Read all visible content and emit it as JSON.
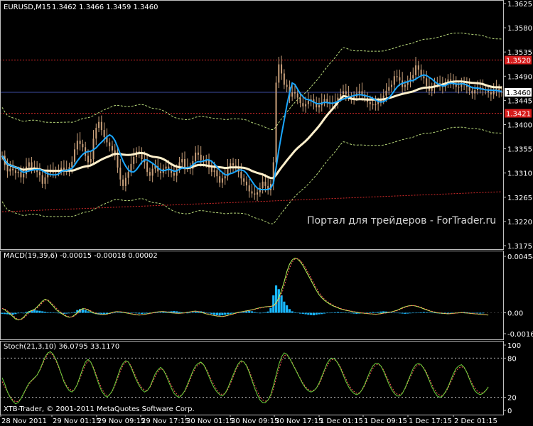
{
  "window": {
    "title": "EURUSD,M15",
    "ohlc": "1.3462 1.3466 1.3459 1.3460"
  },
  "watermark": "Портал для трейдеров - ForTrader.ru",
  "footer": "XTB-Trader, © 2001-2011 MetaQuotes Software Corp.",
  "colors": {
    "background": "#000000",
    "frame": "#c0c0c0",
    "candle": "#c9a07a",
    "ma_fast": "#1aa7ff",
    "ma_slow": "#fff0cc",
    "channel": "#b7d87a",
    "red_level": "#d62a2a",
    "macd_hist": "#18b7ff",
    "macd_signal": "#b8ff5a",
    "macd_red": "#ff5a5a",
    "stoch_main": "#6bd23a",
    "stoch_signal": "#ff5a5a",
    "text": "#ffffff"
  },
  "chart_data": [
    {
      "type": "candlestick",
      "title": "EURUSD,M15",
      "y_ticks": [
        "1.3625",
        "1.3580",
        "1.3535",
        "1.3490",
        "1.3445",
        "1.3400",
        "1.3355",
        "1.3310",
        "1.3265",
        "1.3220",
        "1.3175"
      ],
      "ylim": [
        1.3175,
        1.3625
      ],
      "current_price": "1.3460",
      "red_levels": [
        "1.3520",
        "1.3421"
      ],
      "x_labels": [
        "28 Nov 2011",
        "29 Nov 01:15",
        "29 Nov 09:15",
        "29 Nov 17:15",
        "30 Nov 01:15",
        "30 Nov 09:15",
        "30 Nov 17:15",
        "1 Dec 01:15",
        "1 Dec 09:15",
        "1 Dec 17:15",
        "2 Dec 01:15"
      ],
      "x_positions": [
        0,
        72,
        135,
        197,
        260,
        323,
        385,
        448,
        510,
        573,
        637
      ],
      "series": [
        {
          "name": "close",
          "values": [
            1.3342,
            1.3325,
            1.3313,
            1.3318,
            1.3315,
            1.331,
            1.3312,
            1.3302,
            1.3308,
            1.3322,
            1.333,
            1.3321,
            1.3318,
            1.3312,
            1.3306,
            1.329,
            1.3302,
            1.3312,
            1.3311,
            1.3314,
            1.3312,
            1.3316,
            1.332,
            1.3317,
            1.3314,
            1.3321,
            1.3331,
            1.3354,
            1.337,
            1.3364,
            1.3358,
            1.3342,
            1.333,
            1.3336,
            1.3374,
            1.3394,
            1.3405,
            1.339,
            1.3377,
            1.3367,
            1.336,
            1.3352,
            1.3342,
            1.332,
            1.3298,
            1.3286,
            1.3301,
            1.3312,
            1.3327,
            1.334,
            1.335,
            1.3346,
            1.3336,
            1.333,
            1.3312,
            1.3305,
            1.3318,
            1.3323,
            1.3313,
            1.331,
            1.3318,
            1.3322,
            1.3315,
            1.331,
            1.3305,
            1.3318,
            1.333,
            1.3336,
            1.332,
            1.3321,
            1.3318,
            1.3332,
            1.3348,
            1.3344,
            1.3334,
            1.333,
            1.3334,
            1.332,
            1.3312,
            1.3315,
            1.3304,
            1.3292,
            1.33,
            1.3304,
            1.332,
            1.3328,
            1.3324,
            1.3322,
            1.3312,
            1.33,
            1.3294,
            1.3287,
            1.3276,
            1.3272,
            1.327,
            1.3274,
            1.3282,
            1.3294,
            1.3286,
            1.3278,
            1.329,
            1.333,
            1.3478,
            1.3512,
            1.3495,
            1.3474,
            1.347,
            1.3452,
            1.346,
            1.3458,
            1.345,
            1.344,
            1.3434,
            1.3438,
            1.3444,
            1.3447,
            1.344,
            1.3432,
            1.3436,
            1.3442,
            1.3448,
            1.3442,
            1.344,
            1.3438,
            1.3442,
            1.345,
            1.3457,
            1.3462,
            1.3456,
            1.3452,
            1.3449,
            1.3452,
            1.3458,
            1.3462,
            1.3456,
            1.345,
            1.3442,
            1.3438,
            1.3436,
            1.3438,
            1.3442,
            1.3448,
            1.3454,
            1.3463,
            1.347,
            1.3474,
            1.349,
            1.3488,
            1.3482,
            1.347,
            1.3474,
            1.3481,
            1.3486,
            1.3492,
            1.351,
            1.3502,
            1.349,
            1.3486,
            1.3472,
            1.3463,
            1.347,
            1.3477,
            1.3477,
            1.3473,
            1.347,
            1.3478,
            1.3484,
            1.348,
            1.3474,
            1.347,
            1.347,
            1.3477,
            1.3474,
            1.347,
            1.3463,
            1.3458,
            1.3464,
            1.347,
            1.3468,
            1.3466,
            1.3464,
            1.346,
            1.3456,
            1.3463,
            1.3467,
            1.3462,
            1.346
          ]
        },
        {
          "name": "MA fast"
        },
        {
          "name": "MA slow"
        }
      ]
    },
    {
      "type": "line",
      "title": "MACD(19,39,6) -0.00015 -0.00018 0.00002",
      "y_ticks": [
        "0.00454",
        "0.00",
        "-0.00168"
      ],
      "ylim": [
        -0.00168,
        0.00454
      ],
      "series": [
        {
          "name": "MACD",
          "style": "histogram",
          "values": [
            -8e-05,
            -0.0001,
            -0.00012,
            -0.00016,
            -0.00016,
            -0.0001,
            -4e-05,
            0.0,
            -4e-05,
            8e-05,
            0.00012,
            0.00018,
            0.00024,
            0.00018,
            0.00016,
            0.00012,
            8e-05,
            4e-05,
            4e-05,
            2e-05,
            0.0,
            -4e-05,
            -6e-05,
            -8e-05,
            -6e-05,
            -4e-05,
            -2e-05,
            6e-05,
            0.00022,
            0.0003,
            0.00028,
            0.00022,
            0.00012,
            4e-05,
            -4e-05,
            -0.0001,
            -0.00014,
            -0.00016,
            -0.00014,
            -0.00012,
            -8e-05,
            -4e-05,
            -2e-05,
            2e-05,
            4e-05,
            6e-05,
            4e-05,
            2e-05,
            0.0,
            -2e-05,
            -4e-05,
            -6e-05,
            -8e-05,
            -6e-05,
            -4e-05,
            -2e-05,
            0.0,
            0.0,
            2e-05,
            4e-05,
            6e-05,
            8e-05,
            0.0001,
            0.00012,
            0.00014,
            0.00012,
            8e-05,
            4e-05,
            0.0,
            -4e-05,
            -2e-05,
            4e-05,
            8e-05,
            0.00012,
            0.00012,
            8e-05,
            2e-05,
            -4e-05,
            -0.0001,
            -0.00016,
            -0.0002,
            -0.00022,
            -0.0002,
            -0.00016,
            -0.00012,
            -8e-05,
            -4e-05,
            -2e-05,
            0.0,
            2e-05,
            6e-05,
            0.00012,
            0.00016,
            0.00012,
            6e-05,
            0.0,
            -4e-05,
            -2e-05,
            4e-05,
            0.0001,
            0.0004,
            0.0014,
            0.0022,
            0.0019,
            0.0014,
            0.0009,
            0.0006,
            0.0003,
            0.00012,
            4e-05,
            -2e-05,
            -6e-05,
            -8e-05,
            -0.00012,
            -0.00016,
            -0.00018,
            -0.0002,
            -0.00016,
            -0.00012,
            -0.0001,
            -6e-05,
            -2e-05,
            0.0,
            2e-05,
            4e-05,
            6e-05,
            4e-05,
            2e-05,
            0.0,
            -2e-05,
            -4e-05,
            -6e-05,
            -8e-05,
            -6e-05,
            -2e-05,
            0.0,
            2e-05,
            4e-05,
            6e-05,
            4e-05,
            6e-05,
            0.0001,
            0.00012,
            0.0001,
            8e-05,
            4e-05,
            0.0,
            -2e-05,
            -4e-05,
            -6e-05,
            -8e-05,
            -6e-05,
            -4e-05,
            -2e-05,
            0.0,
            2e-05,
            4e-05,
            6e-05,
            4e-05,
            2e-05,
            0.0,
            -2e-05,
            -4e-05,
            -6e-05,
            -8e-05,
            -8e-05,
            -6e-05,
            -4e-05,
            -2e-05,
            0.0,
            2e-05,
            4e-05,
            6e-05,
            4e-05,
            2e-05,
            0.0,
            -2e-05,
            -4e-05,
            -6e-05,
            -4e-05
          ]
        },
        {
          "name": "Signal",
          "style": "dotted",
          "values": [
            0.00036,
            0.00024,
            6e-05,
            -0.0001,
            -0.0003,
            -0.0005,
            -0.00058,
            -0.00052,
            -0.00036,
            -0.0001,
            0.0001,
            0.00018,
            0.00028,
            0.00046,
            0.0007,
            0.00094,
            0.00108,
            0.001,
            0.00078,
            0.00054,
            0.00028,
            0.0001,
            -4e-05,
            -0.00018,
            -0.0003,
            -0.00036,
            -0.00032,
            -0.00018,
            2e-05,
            0.00022,
            0.00034,
            0.00032,
            0.00022,
            0.0001,
            0.0,
            -6e-05,
            -0.0001,
            -0.00012,
            -0.00014,
            -0.0001,
            -4e-05,
            2e-05,
            8e-05,
            0.0001,
            8e-05,
            4e-05,
            0.0,
            -4e-05,
            -8e-05,
            -0.00012,
            -0.00016,
            -0.00018,
            -0.00016,
            -0.00012,
            -8e-05,
            -4e-05,
            0.0,
            4e-05,
            8e-05,
            0.0001,
            0.0001,
            8e-05,
            4e-05,
            0.0,
            -2e-05,
            -4e-05,
            -4e-05,
            -2e-05,
            0.0,
            4e-05,
            8e-05,
            0.00012,
            0.00014,
            0.0001,
            4e-05,
            -2e-05,
            -8e-05,
            -0.00014,
            -0.00018,
            -0.00022,
            -0.00026,
            -0.00028,
            -0.0003,
            -0.00026,
            -0.0002,
            -0.00014,
            -8e-05,
            -2e-05,
            4e-05,
            8e-05,
            0.00012,
            0.00016,
            0.0002,
            0.00024,
            0.0003,
            0.00036,
            0.0004,
            0.00044,
            0.00048,
            0.0005,
            0.00052,
            0.00056,
            0.0008,
            0.0012,
            0.0018,
            0.0025,
            0.0033,
            0.0039,
            0.00425,
            0.0044,
            0.00432,
            0.0041,
            0.0038,
            0.0034,
            0.003,
            0.0026,
            0.0022,
            0.0018,
            0.00145,
            0.0012,
            0.001,
            0.00085,
            0.0007,
            0.00058,
            0.00048,
            0.0004,
            0.00032,
            0.00026,
            0.0002,
            0.00016,
            0.00012,
            8e-05,
            4e-05,
            0.0,
            -2e-05,
            -4e-05,
            -6e-05,
            -8e-05,
            -0.0001,
            -0.00012,
            -0.0001,
            -6e-05,
            -2e-05,
            0.0,
            4e-05,
            8e-05,
            0.00014,
            0.0002,
            0.0003,
            0.0004,
            0.00048,
            0.00054,
            0.00058,
            0.00058,
            0.00054,
            0.00048,
            0.0004,
            0.00032,
            0.00024,
            0.00016,
            0.0001,
            4e-05,
            0.0,
            -2e-05,
            -4e-05,
            -6e-05,
            -8e-05,
            -6e-05,
            -4e-05,
            -2e-05,
            0.0,
            2e-05,
            0.0,
            -2e-05,
            -4e-05,
            -6e-05,
            -8e-05,
            -0.0001,
            -0.00012,
            -0.00014,
            -0.00016,
            -0.00018
          ]
        }
      ]
    },
    {
      "type": "line",
      "title": "Stoch(21,3,10) 36.0795 33.1170",
      "y_ticks": [
        "100",
        "80",
        "20",
        "0"
      ],
      "ylim": [
        0,
        100
      ],
      "series": [
        {
          "name": "Main",
          "values": [
            50,
            40,
            28,
            20,
            14,
            10,
            12,
            18,
            26,
            34,
            42,
            46,
            50,
            54,
            62,
            72,
            82,
            88,
            90,
            86,
            78,
            68,
            56,
            44,
            36,
            30,
            28,
            32,
            40,
            52,
            64,
            74,
            78,
            74,
            64,
            52,
            40,
            30,
            24,
            20,
            24,
            30,
            40,
            52,
            64,
            72,
            76,
            74,
            66,
            56,
            46,
            38,
            32,
            28,
            30,
            36,
            46,
            56,
            62,
            66,
            62,
            54,
            44,
            34,
            26,
            22,
            20,
            24,
            30,
            40,
            50,
            60,
            68,
            72,
            74,
            70,
            62,
            52,
            42,
            34,
            28,
            24,
            22,
            26,
            34,
            44,
            54,
            64,
            72,
            76,
            74,
            68,
            58,
            46,
            34,
            24,
            16,
            12,
            12,
            16,
            24,
            38,
            54,
            70,
            82,
            88,
            86,
            80,
            72,
            64,
            56,
            48,
            40,
            34,
            30,
            28,
            30,
            34,
            42,
            52,
            62,
            72,
            78,
            80,
            78,
            72,
            64,
            54,
            44,
            36,
            30,
            26,
            24,
            26,
            32,
            40,
            50,
            60,
            68,
            72,
            72,
            68,
            60,
            50,
            40,
            32,
            26,
            22,
            22,
            26,
            34,
            44,
            54,
            64,
            70,
            72,
            70,
            64,
            56,
            46,
            36,
            28,
            22,
            20,
            22,
            28,
            36,
            46,
            56,
            64,
            68,
            70,
            66,
            58,
            48,
            38,
            30,
            26,
            24,
            26,
            30,
            36
          ]
        },
        {
          "name": "Signal",
          "style": "dotted",
          "values": [
            44,
            36,
            28,
            21,
            16,
            13,
            14,
            18,
            25,
            33,
            40,
            45,
            49,
            54,
            61,
            70,
            79,
            86,
            88,
            84,
            76,
            66,
            56,
            46,
            38,
            33,
            30,
            33,
            39,
            49,
            60,
            70,
            76,
            74,
            66,
            55,
            44,
            34,
            27,
            23,
            24,
            29,
            38,
            49,
            60,
            69,
            74,
            74,
            68,
            59,
            49,
            41,
            35,
            31,
            31,
            35,
            43,
            52,
            59,
            64,
            62,
            56,
            47,
            38,
            30,
            25,
            22,
            24,
            29,
            37,
            47,
            57,
            65,
            70,
            72,
            70,
            64,
            55,
            46,
            38,
            31,
            26,
            24,
            26,
            32,
            41,
            51,
            61,
            69,
            74,
            74,
            69,
            61,
            50,
            39,
            29,
            21,
            16,
            14,
            16,
            22,
            33,
            48,
            63,
            76,
            84,
            85,
            80,
            73,
            65,
            57,
            49,
            42,
            36,
            32,
            30,
            31,
            34,
            40,
            49,
            59,
            68,
            75,
            78,
            77,
            73,
            66,
            57,
            48,
            40,
            33,
            29,
            26,
            27,
            31,
            38,
            47,
            56,
            64,
            69,
            71,
            68,
            62,
            53,
            44,
            36,
            29,
            25,
            24,
            27,
            33,
            42,
            51,
            60,
            67,
            70,
            69,
            65,
            58,
            49,
            40,
            32,
            26,
            23,
            23,
            27,
            34,
            43,
            52,
            60,
            65,
            67,
            65,
            59,
            50,
            41,
            34,
            29,
            27,
            27,
            30,
            35
          ]
        }
      ]
    }
  ]
}
